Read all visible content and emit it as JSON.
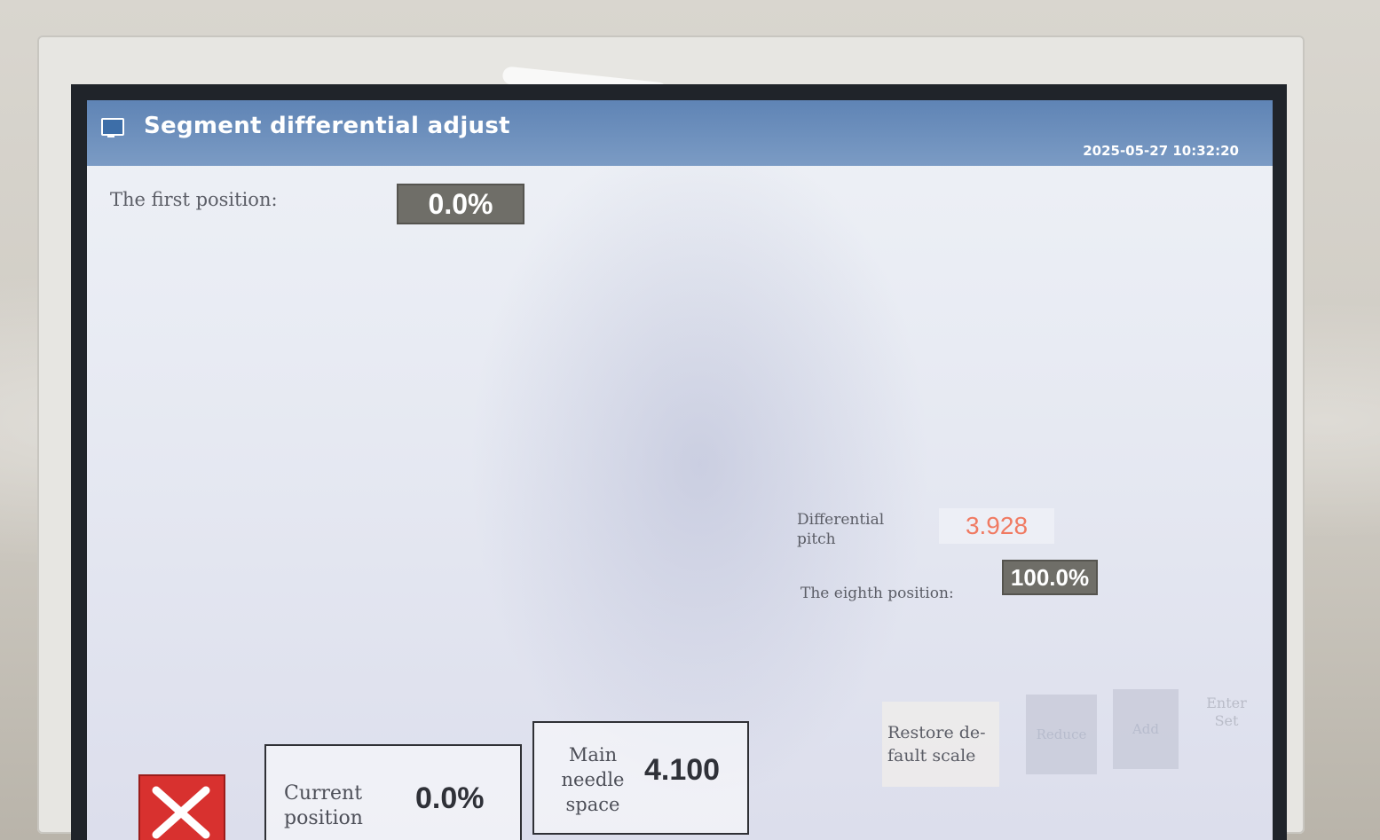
{
  "window": {
    "title": "Segment differential adjust",
    "datetime": "2025-05-27 10:32:20"
  },
  "fields": {
    "first_position_label": "The first position:",
    "first_position_value": "0.0%",
    "differential_pitch_label": "Differential pitch",
    "differential_pitch_value": "3.928",
    "eighth_position_label": "The eighth position:",
    "eighth_position_value": "100.0%"
  },
  "status": {
    "current_position_label": "Current position",
    "current_position_value": "0.0%",
    "main_needle_space_label": "Main needle space",
    "main_needle_space_value": "4.100"
  },
  "buttons": {
    "restore_default_scale": "Restore de- fault scale",
    "reduce": "Reduce",
    "add": "Add",
    "enter_set": "Enter Set"
  },
  "colors": {
    "title_bar": "#6b8dbb",
    "close_button": "#d8312f",
    "differential_pitch_text": "#f07a62",
    "value_box": "#6f6e68"
  }
}
